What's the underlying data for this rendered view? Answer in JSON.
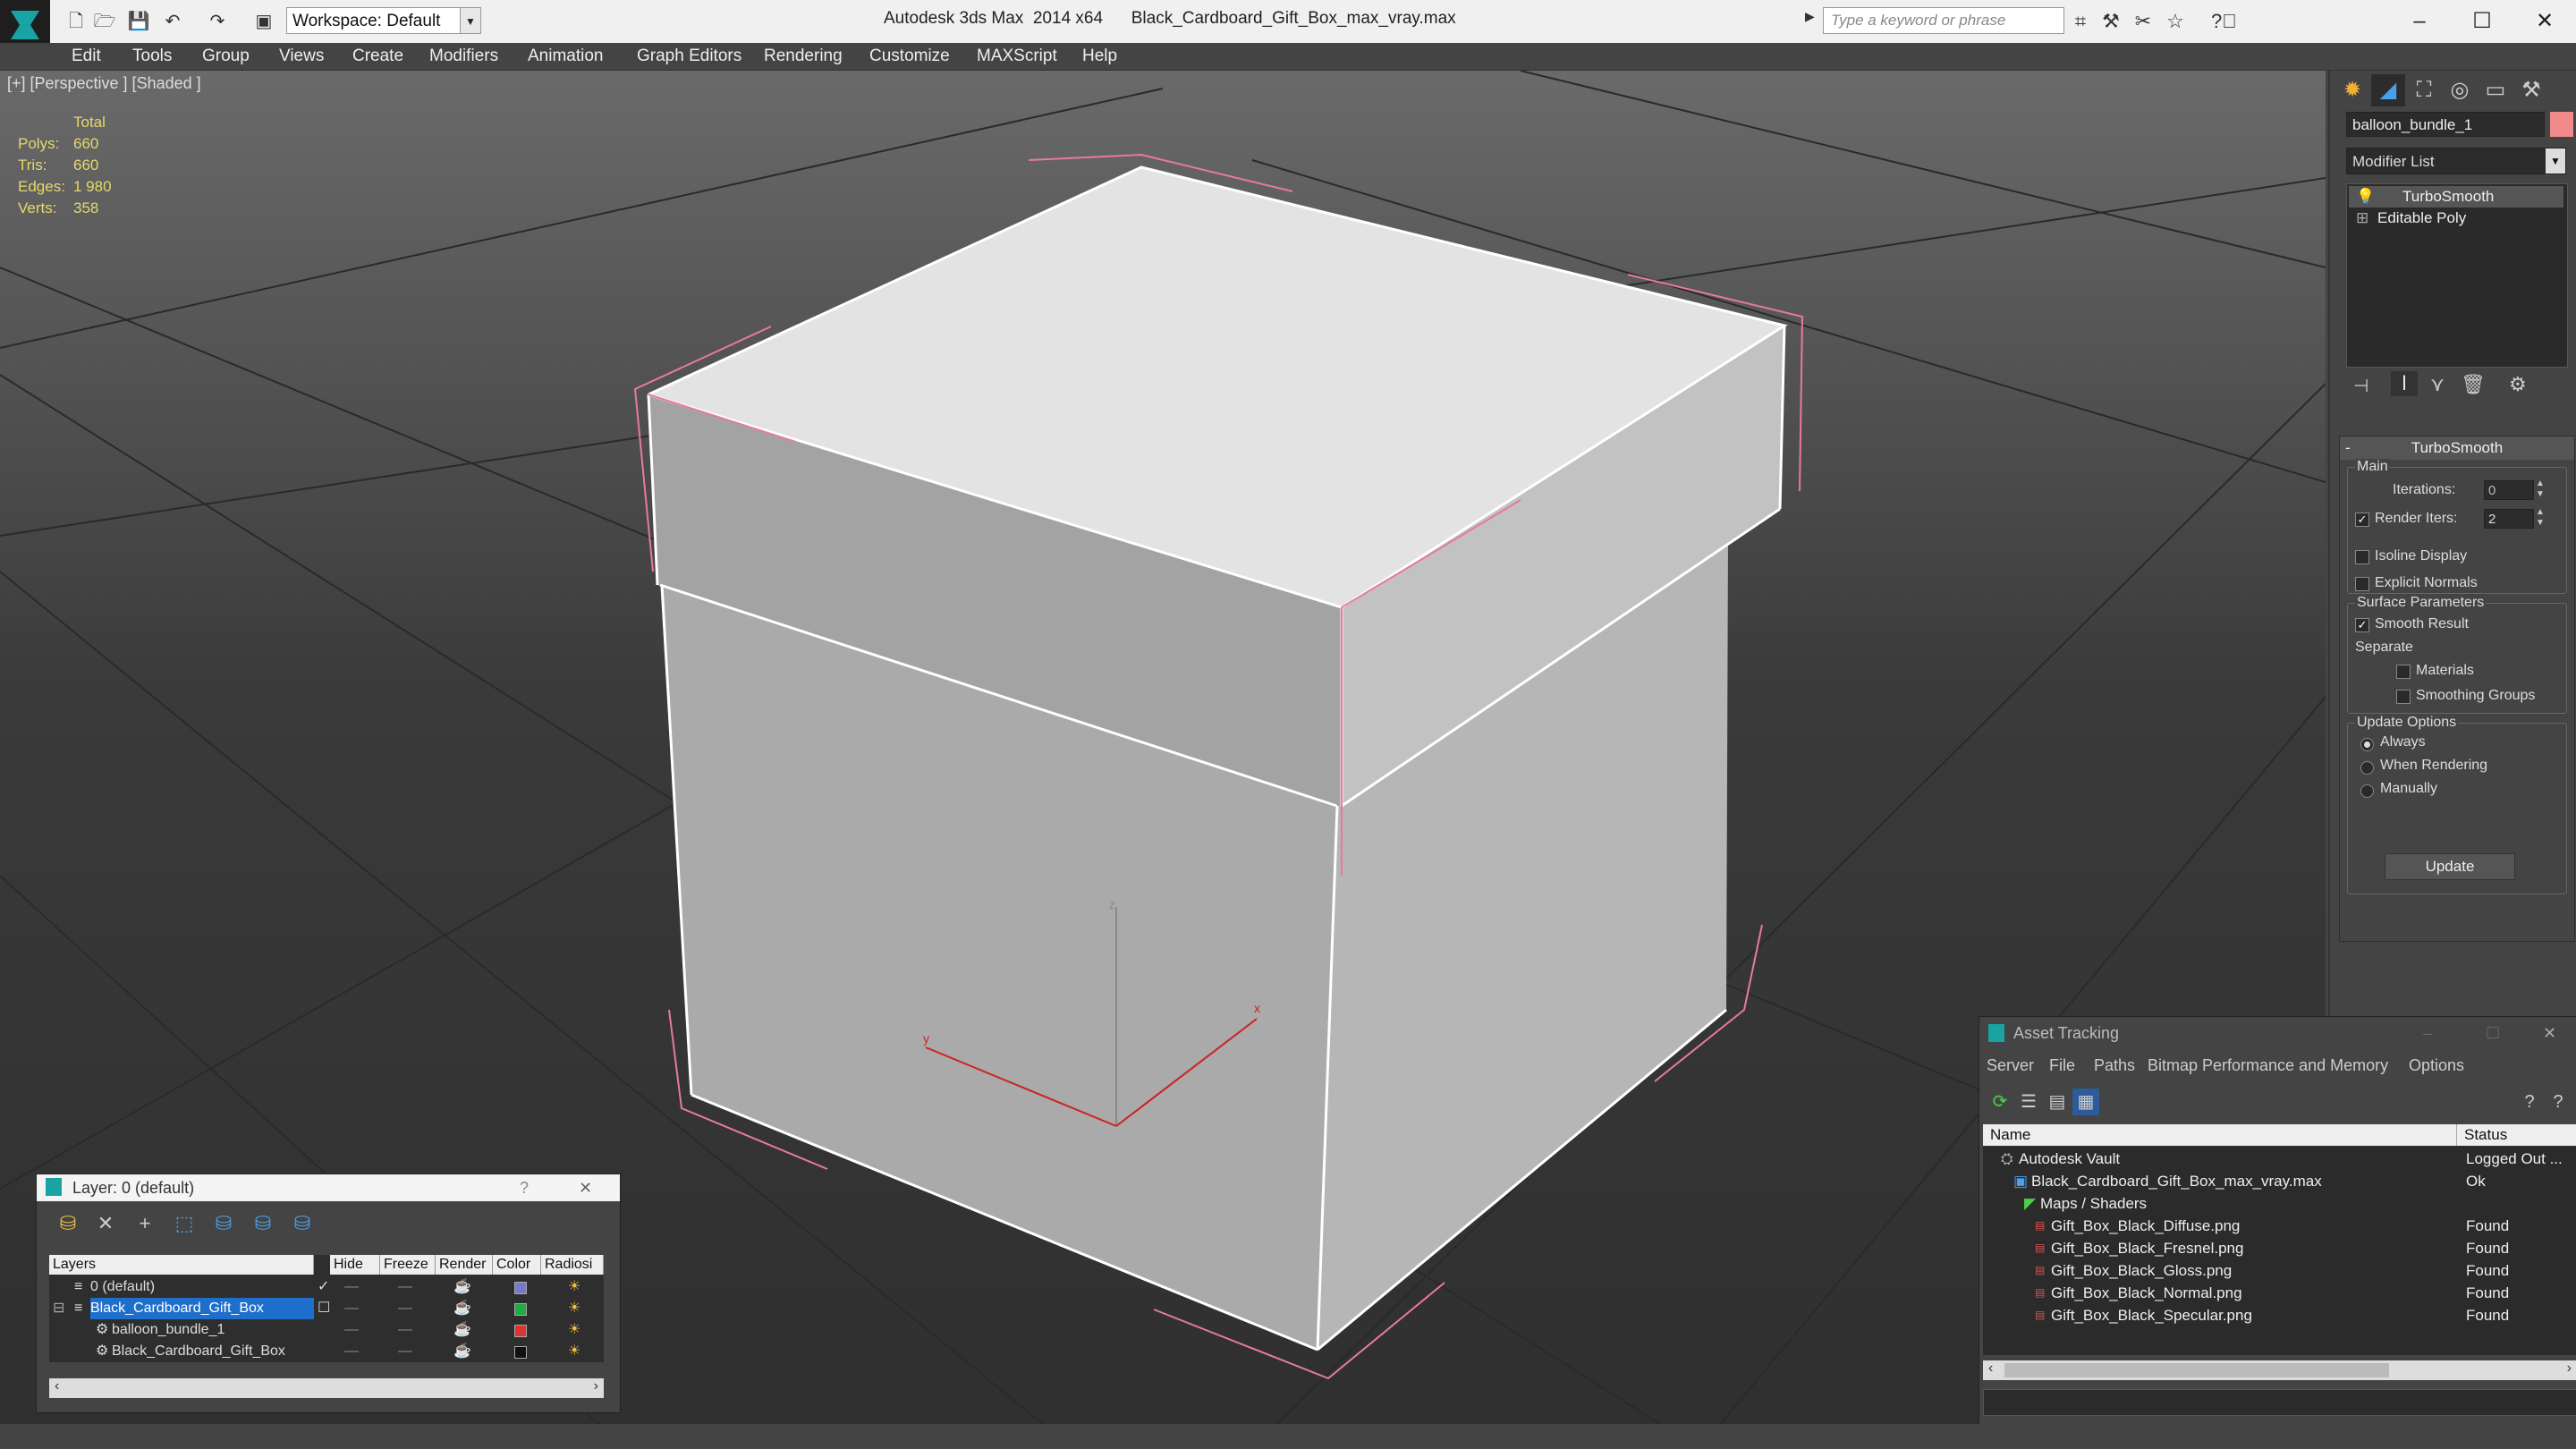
{
  "app": {
    "title": "Autodesk 3ds Max  2014 x64",
    "file": "Black_Cardboard_Gift_Box_max_vray.max",
    "workspace": "Workspace: Default",
    "search_placeholder": "Type a keyword or phrase"
  },
  "menu": [
    "Edit",
    "Tools",
    "Group",
    "Views",
    "Create",
    "Modifiers",
    "Animation",
    "Graph Editors",
    "Rendering",
    "Customize",
    "MAXScript",
    "Help"
  ],
  "viewport": {
    "label": "[+] [Perspective ] [Shaded ]",
    "stats": {
      "header": "Total",
      "polys_label": "Polys:",
      "polys": "660",
      "tris_label": "Tris:",
      "tris": "660",
      "edges_label": "Edges:",
      "edges": "1 980",
      "verts_label": "Verts:",
      "verts": "358"
    },
    "gizmo": {
      "x": "x",
      "y": "y",
      "z": "z"
    }
  },
  "command_panel": {
    "object_name": "balloon_bundle_1",
    "object_color": "#f08a8a",
    "modifier_list": "Modifier List",
    "stack": [
      "TurboSmooth",
      "Editable Poly"
    ],
    "turbosmooth": {
      "title": "TurboSmooth",
      "main": "Main",
      "iterations_label": "Iterations:",
      "iterations": "0",
      "render_iters_label": "Render Iters:",
      "render_iters": "2",
      "isoline": "Isoline Display",
      "explicit_normals": "Explicit Normals",
      "surface_params": "Surface Parameters",
      "smooth_result": "Smooth Result",
      "separate": "Separate",
      "materials": "Materials",
      "smoothing_groups": "Smoothing Groups",
      "update_options": "Update Options",
      "always": "Always",
      "when_rendering": "When Rendering",
      "manually": "Manually",
      "update": "Update"
    }
  },
  "layer_dialog": {
    "title": "Layer: 0 (default)",
    "help": "?",
    "columns": [
      "Layers",
      "Hide",
      "Freeze",
      "Render",
      "Color",
      "Radiosi"
    ],
    "rows": [
      {
        "name": "0 (default)",
        "color": "#7777cc"
      },
      {
        "name": "Black_Cardboard_Gift_Box",
        "color": "#22aa44"
      },
      {
        "name": "balloon_bundle_1",
        "color": "#dd3333"
      },
      {
        "name": "Black_Cardboard_Gift_Box",
        "color": "#111111"
      }
    ]
  },
  "asset_tracking": {
    "title": "Asset Tracking",
    "menu": [
      "Server",
      "File",
      "Paths",
      "Bitmap Performance and Memory",
      "Options"
    ],
    "columns": [
      "Name",
      "Status"
    ],
    "rows": [
      {
        "name": "Autodesk Vault",
        "status": "Logged Out ..."
      },
      {
        "name": "Black_Cardboard_Gift_Box_max_vray.max",
        "status": "Ok"
      },
      {
        "name": "Maps / Shaders",
        "status": ""
      },
      {
        "name": "Gift_Box_Black_Diffuse.png",
        "status": "Found"
      },
      {
        "name": "Gift_Box_Black_Fresnel.png",
        "status": "Found"
      },
      {
        "name": "Gift_Box_Black_Gloss.png",
        "status": "Found"
      },
      {
        "name": "Gift_Box_Black_Normal.png",
        "status": "Found"
      },
      {
        "name": "Gift_Box_Black_Specular.png",
        "status": "Found"
      }
    ]
  }
}
